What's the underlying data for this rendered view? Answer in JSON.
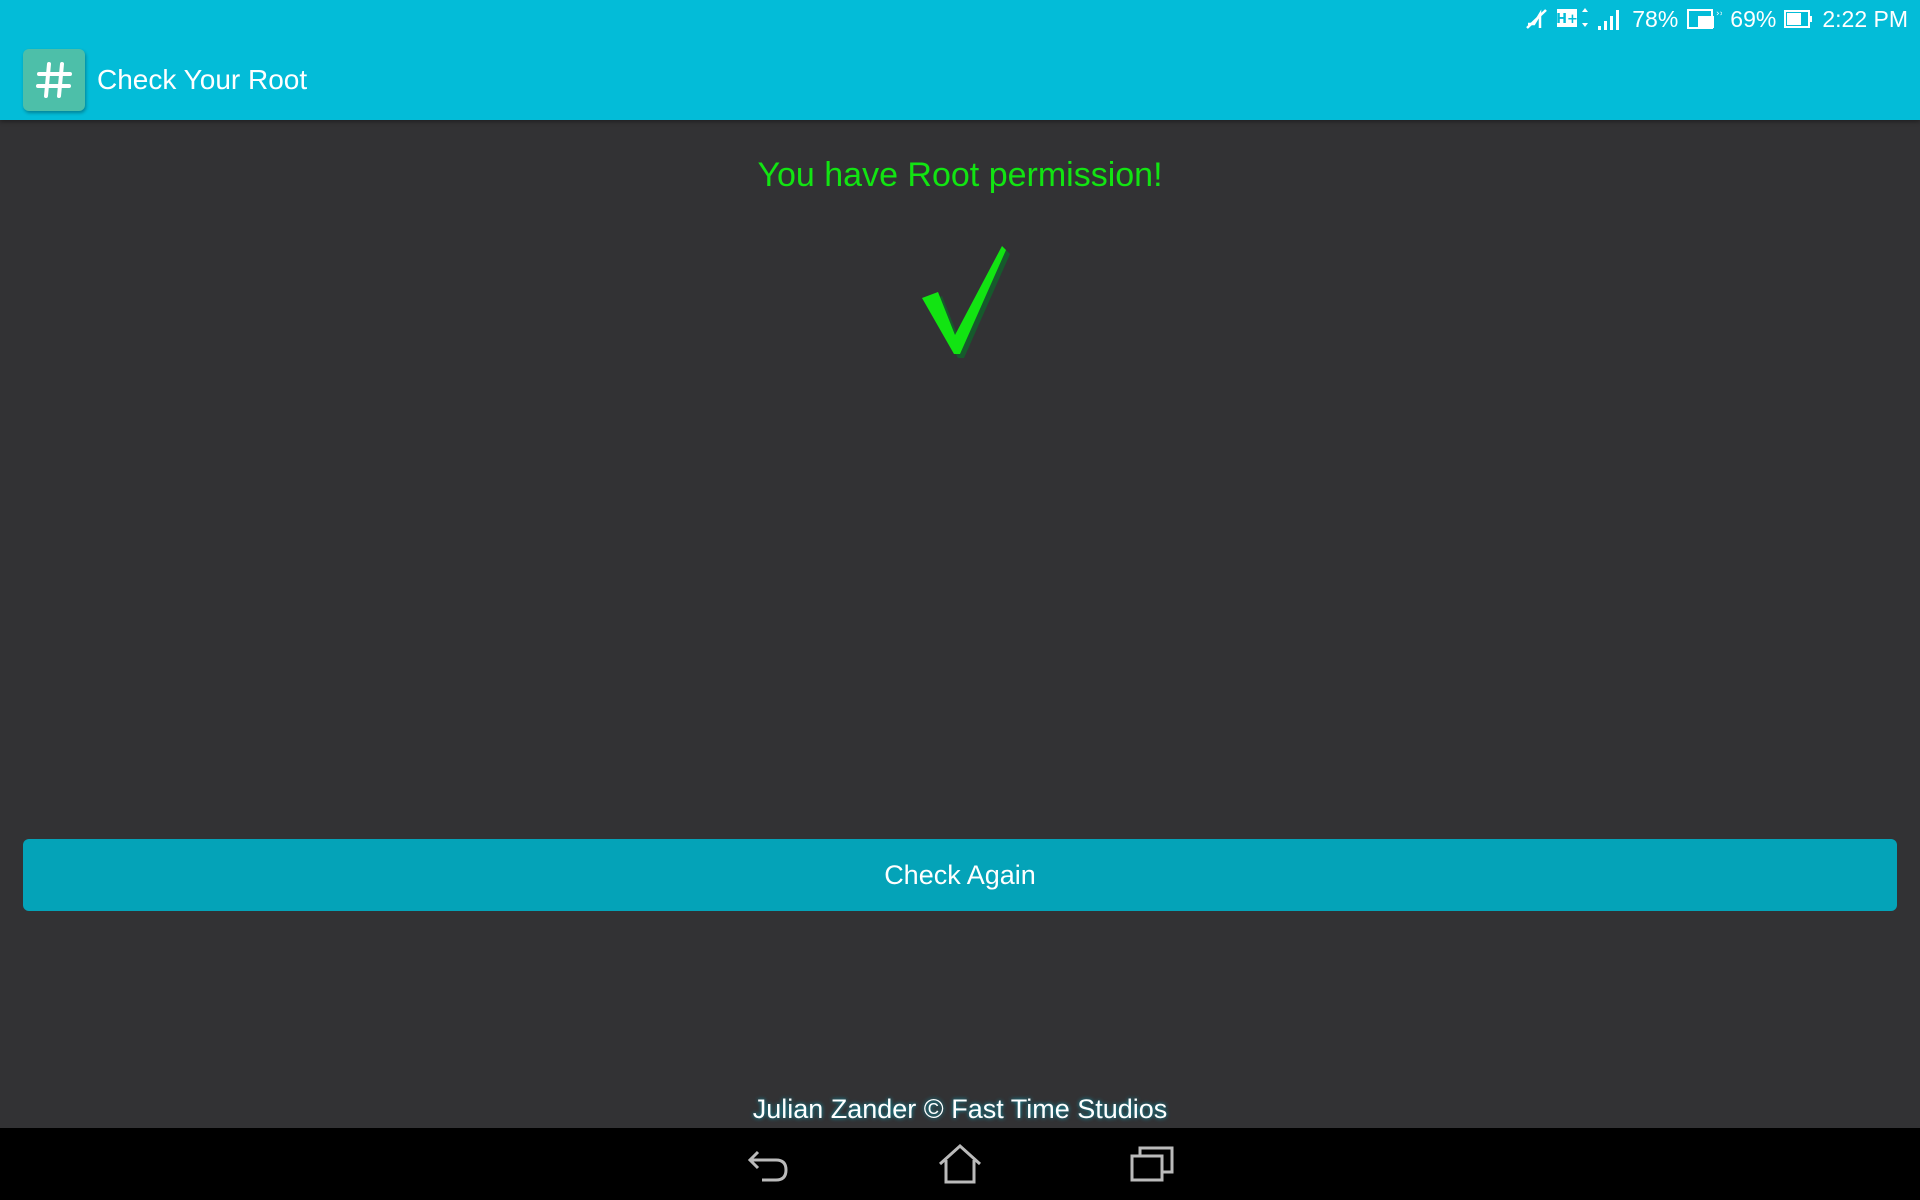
{
  "status_bar": {
    "signal_type": "H+",
    "battery_1": "78%",
    "battery_2": "69%",
    "time": "2:22 PM",
    "icons": [
      "mute-icon",
      "h-plus-icon",
      "signal-icon",
      "battery-icon",
      "dock-battery-icon",
      "battery-icon"
    ]
  },
  "app_bar": {
    "icon_glyph": "#",
    "title": "Check Your Root"
  },
  "main": {
    "status_message": "You have Root permission!",
    "status_icon": "check-mark-icon",
    "check_button_label": "Check Again",
    "credit": "Julian Zander © Fast Time Studios"
  },
  "nav_bar": {
    "icons": [
      "back-icon",
      "home-icon",
      "recent-apps-icon"
    ]
  },
  "colors": {
    "accent": "#03BCD8",
    "button": "#04A3B8",
    "success": "#12E412",
    "background": "#323234"
  }
}
